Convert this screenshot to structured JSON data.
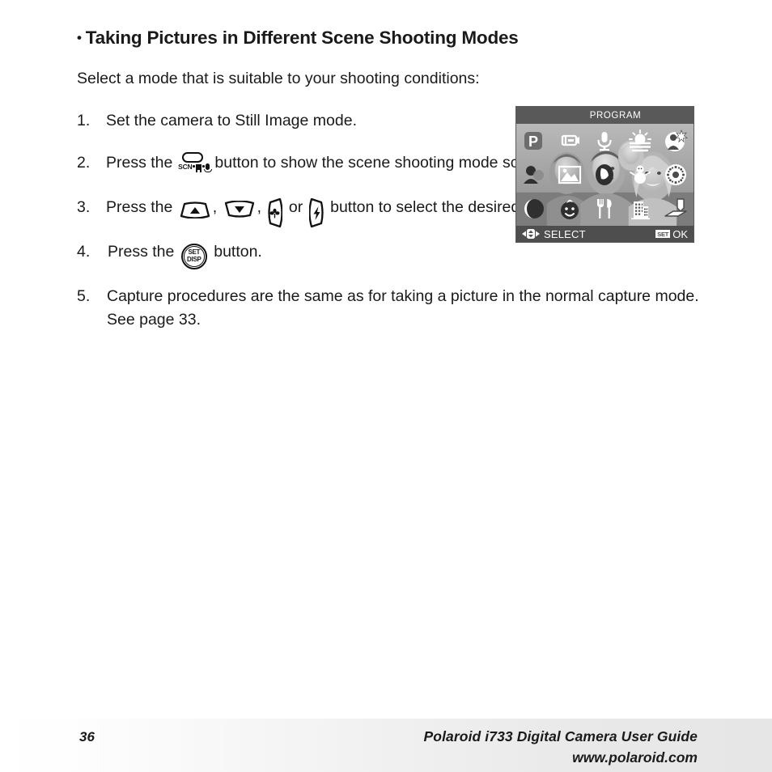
{
  "heading": {
    "bullet": "•",
    "text": "Taking Pictures in Different Scene Shooting Modes"
  },
  "intro": "Select a mode that is suitable to your shooting conditions:",
  "steps": [
    {
      "number": "1.",
      "text_before": "Set the camera to Still Image mode.",
      "text_after": ""
    },
    {
      "number": "2.",
      "text_before": "Press the",
      "text_after": "button to show the scene shooting mode screen.",
      "icon": "scn-mode-button-icon",
      "icon_label": "SCN"
    },
    {
      "number": "3.",
      "text_before": "Press the",
      "separator1": ",",
      "separator2": ",",
      "conjunction": "or",
      "text_after": "button to select the desired setting.",
      "icons": [
        "up-button-icon",
        "down-button-icon",
        "left-macro-button-icon",
        "right-flash-button-icon"
      ]
    },
    {
      "number": "4.",
      "text_before": "Press the",
      "text_after": "button.",
      "icon": "set-disp-button-icon",
      "icon_line1": "SET",
      "icon_line2": "DISP"
    },
    {
      "number": "5.",
      "text_before": "Capture procedures are the same as for taking a picture in the normal capture mode. See page 33.",
      "text_after": ""
    }
  ],
  "lcd": {
    "header_title": "PROGRAM",
    "footer_select_label": "SELECT",
    "footer_set_badge": "SET",
    "footer_ok_label": "OK",
    "mode_icons": [
      {
        "name": "program-mode-icon",
        "label": "P"
      },
      {
        "name": "movie-mode-icon",
        "label": ""
      },
      {
        "name": "voice-recorder-mode-icon",
        "label": ""
      },
      {
        "name": "sunset-mode-icon",
        "label": ""
      },
      {
        "name": "night-portrait-mode-icon",
        "label": ""
      },
      {
        "name": "portrait-mode-icon",
        "label": ""
      },
      {
        "name": "landscape-mode-icon",
        "label": ""
      },
      {
        "name": "backlight-mode-icon",
        "label": ""
      },
      {
        "name": "snow-mode-icon",
        "label": ""
      },
      {
        "name": "fireworks-mode-icon",
        "label": ""
      },
      {
        "name": "night-scene-mode-icon",
        "label": ""
      },
      {
        "name": "children-mode-icon",
        "label": ""
      },
      {
        "name": "food-mode-icon",
        "label": ""
      },
      {
        "name": "building-mode-icon",
        "label": ""
      },
      {
        "name": "text-mode-icon",
        "label": ""
      }
    ],
    "colors": {
      "header_bar": "#595959",
      "footer_bar": "#4e4e4e",
      "screen_bg": "#8e8e8e"
    }
  },
  "footer": {
    "page_number": "36",
    "guide_title": "Polaroid i733 Digital Camera User Guide",
    "website": "www.polaroid.com"
  }
}
